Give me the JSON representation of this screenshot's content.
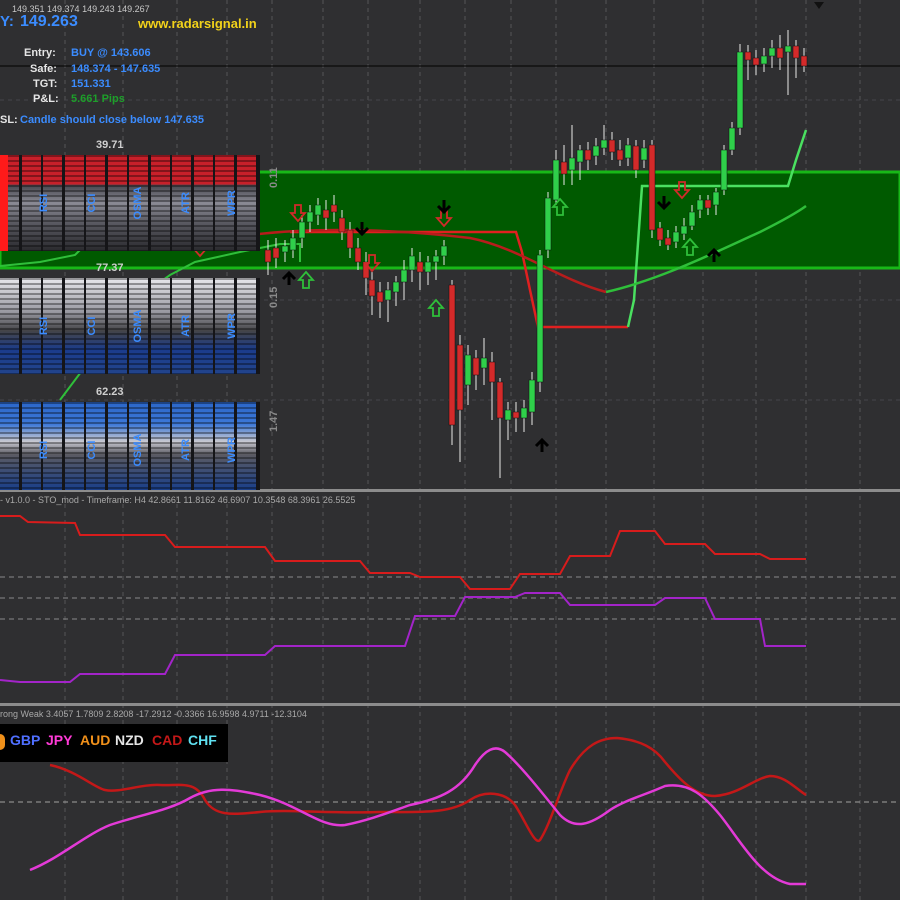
{
  "header": {
    "price_label": "Y:",
    "price": "149.263",
    "quotes": "149.351 149.374 149.243 149.267",
    "website": "www.radarsignal.in"
  },
  "trade": {
    "entry_label": "Entry:",
    "entry_value": "BUY @ 143.606",
    "safe_label": "Safe:",
    "safe_value": "148.374 - 147.635",
    "tgt_label": "TGT:",
    "tgt_value": "151.331",
    "pl_label": "P&L:",
    "pl_value": "5.661 Pips",
    "sl_label": "SL:",
    "sl_value": "Candle should close below 147.635"
  },
  "panels": [
    {
      "value": "39.71",
      "labels": [
        "RSI",
        "CCI",
        "OSMA",
        "ATR",
        "WPR"
      ],
      "scale": "0.11"
    },
    {
      "value": "77.37",
      "labels": [
        "RSI",
        "CCI",
        "OSMA",
        "ATR",
        "WPR"
      ],
      "scale": "0.15"
    },
    {
      "value": "62.23",
      "labels": [
        "RSI",
        "CCI",
        "OSMA",
        "ATR",
        "WPR"
      ],
      "scale": "1.47"
    }
  ],
  "sto": {
    "header": "- v1.0.0 - STO_mod - Timeframe: H4 42.8661 11.8162 46.6907 10.3548 68.3961 26.5525"
  },
  "strength": {
    "header": "rong Weak 3.4057 1.7809 2.8208 -17.2912 -0.3366 16.9598 4.9711 -12.3104",
    "legend": [
      {
        "label": "GBP",
        "color": "#4f6fff"
      },
      {
        "label": "JPY",
        "color": "#ff3ad7"
      },
      {
        "label": "AUD",
        "color": "#f0901a"
      },
      {
        "label": "NZD",
        "color": "#e6e6e6"
      },
      {
        "label": "CAD",
        "color": "#c41818"
      },
      {
        "label": "CHF",
        "color": "#5fe0f0"
      }
    ]
  },
  "colors": {
    "background": "#2f2f31",
    "bull_candle": "#2fd04a",
    "bear_candle": "#d42a2a",
    "zone": "#005c00",
    "title_blue": "#3b8cff",
    "website_yellow": "#f2d21a"
  }
}
